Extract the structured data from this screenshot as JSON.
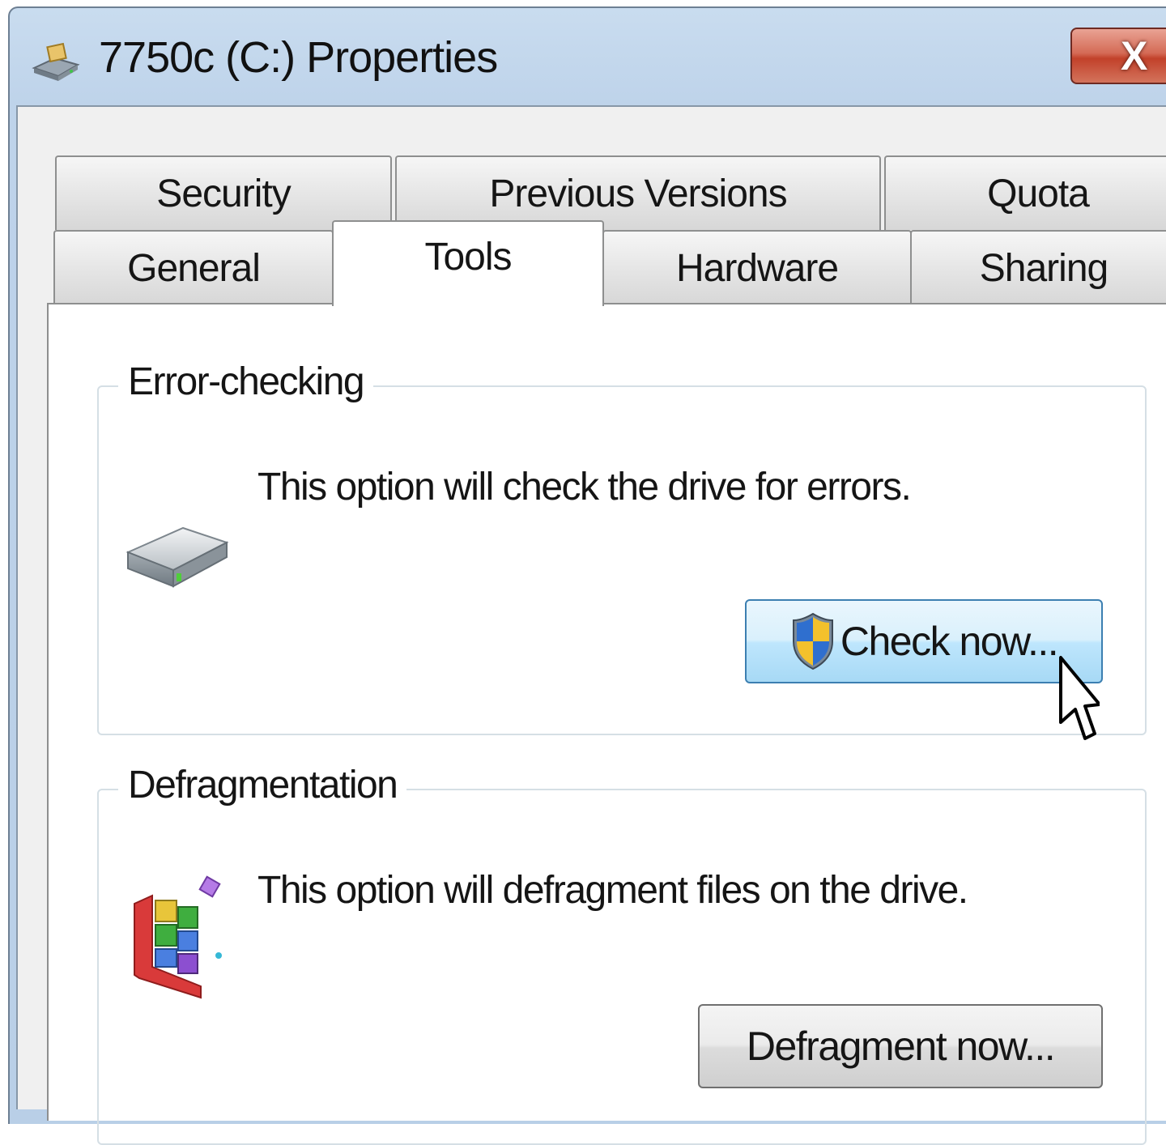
{
  "window": {
    "title": "7750c (C:) Properties",
    "close_label": "X"
  },
  "tabs": {
    "row1": [
      {
        "label": "Security"
      },
      {
        "label": "Previous Versions"
      },
      {
        "label": "Quota"
      }
    ],
    "row2": [
      {
        "label": "General"
      },
      {
        "label": "Tools",
        "active": true
      },
      {
        "label": "Hardware"
      },
      {
        "label": "Sharing"
      }
    ]
  },
  "error_checking": {
    "title": "Error-checking",
    "description": "This option will check the drive for errors.",
    "button_label": "Check now...",
    "icon": "hard-drive-icon"
  },
  "defragmentation": {
    "title": "Defragmentation",
    "description": "This option will defragment files on the drive.",
    "button_label": "Defragment now...",
    "icon": "defragment-icon"
  },
  "colors": {
    "title_bar": "#c9dcef",
    "close_button": "#c2412a",
    "hover_button": "#bee6fd"
  }
}
